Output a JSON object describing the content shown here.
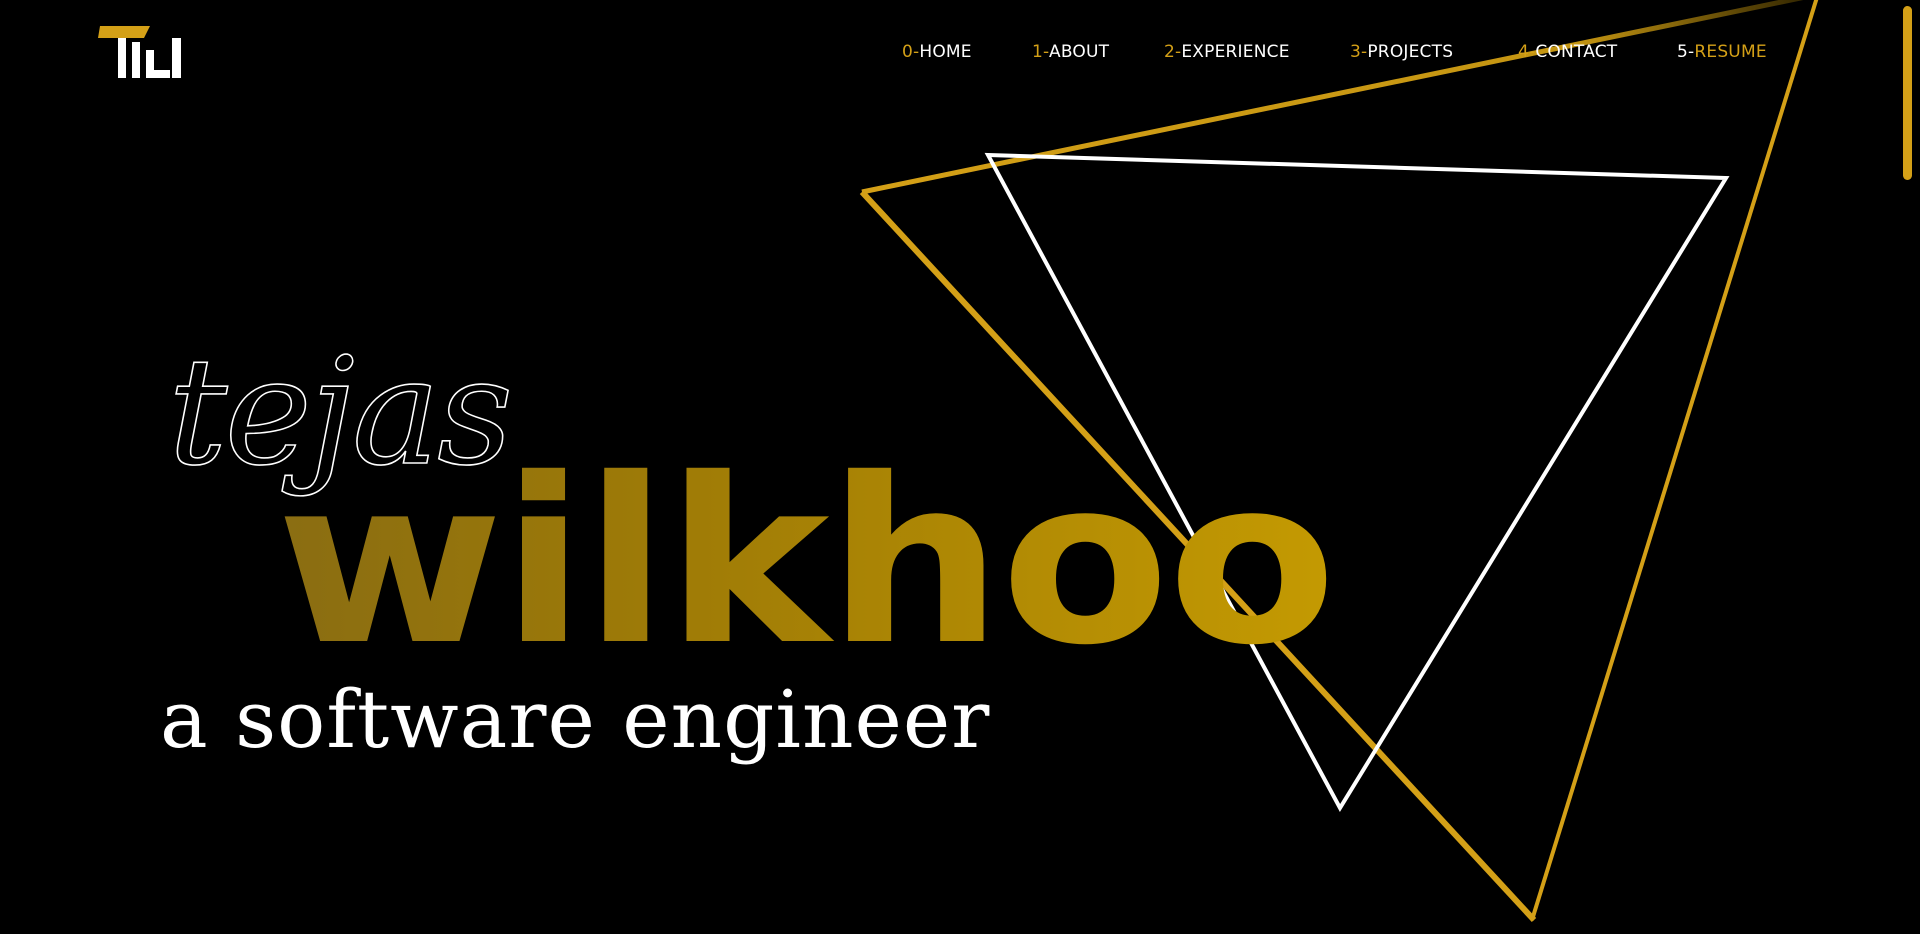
{
  "logo": {
    "name": "TW logo"
  },
  "nav": {
    "items": [
      {
        "num": "0-",
        "label": "HOME"
      },
      {
        "num": "1-",
        "label": "ABOUT"
      },
      {
        "num": "2-",
        "label": "EXPERIENCE"
      },
      {
        "num": "3-",
        "label": "PROJECTS"
      },
      {
        "num": "4-",
        "label": "CONTACT"
      },
      {
        "num": "5-",
        "label": "RESUME"
      }
    ]
  },
  "hero": {
    "first_name": "tejas",
    "last_name": "wilkhoo",
    "tagline": "a software engineer"
  },
  "colors": {
    "background": "#000000",
    "accent": "#d4a017",
    "text": "#ffffff"
  }
}
